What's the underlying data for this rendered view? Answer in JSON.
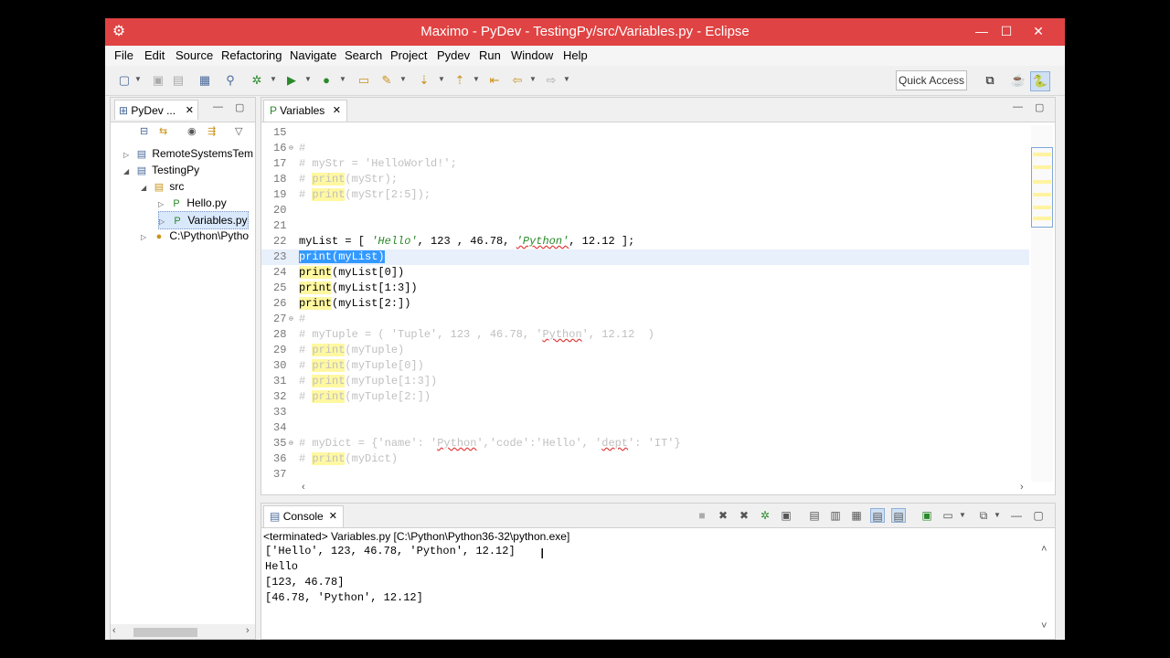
{
  "window": {
    "title": "Maximo - PyDev - TestingPy/src/Variables.py - Eclipse",
    "minimize": "—",
    "maximize": "☐",
    "close": "✕"
  },
  "menu": [
    "File",
    "Edit",
    "Source",
    "Refactoring",
    "Navigate",
    "Search",
    "Project",
    "Pydev",
    "Run",
    "Window",
    "Help"
  ],
  "toolbar": {
    "quick_access": "Quick Access"
  },
  "explorer": {
    "tab_label": "PyDev ...",
    "tree": [
      {
        "label": "RemoteSystemsTem",
        "icon": "folder-icon",
        "arrow": "▷",
        "indent": 0
      },
      {
        "label": "TestingPy",
        "icon": "project-icon",
        "arrow": "◢",
        "indent": 0
      },
      {
        "label": "src",
        "icon": "package-folder-icon",
        "arrow": "◢",
        "indent": 1
      },
      {
        "label": "Hello.py",
        "icon": "python-file-icon",
        "arrow": "▷",
        "indent": 2
      },
      {
        "label": "Variables.py",
        "icon": "python-file-icon",
        "arrow": "▷",
        "indent": 2
      },
      {
        "label": "C:\\Python\\Pytho",
        "icon": "python-interpreter-icon",
        "arrow": "▷",
        "indent": 1
      }
    ]
  },
  "editor": {
    "tab_label": "Variables",
    "lines": [
      {
        "n": "15",
        "segs": []
      },
      {
        "n": "16",
        "fold": "⊖",
        "segs": [
          {
            "t": "#",
            "c": "cm"
          }
        ]
      },
      {
        "n": "17",
        "segs": [
          {
            "t": "# myStr = 'HelloWorld!';",
            "c": "cm"
          }
        ]
      },
      {
        "n": "18",
        "segs": [
          {
            "t": "# ",
            "c": "cm"
          },
          {
            "t": "print",
            "c": "kwc"
          },
          {
            "t": "(myStr);",
            "c": "cm"
          }
        ]
      },
      {
        "n": "19",
        "segs": [
          {
            "t": "# ",
            "c": "cm"
          },
          {
            "t": "print",
            "c": "kwc"
          },
          {
            "t": "(myStr[2:5]);",
            "c": "cm"
          }
        ]
      },
      {
        "n": "20",
        "segs": []
      },
      {
        "n": "21",
        "segs": []
      },
      {
        "n": "22",
        "segs": [
          {
            "t": "myList = [ ",
            "c": ""
          },
          {
            "t": "'Hello'",
            "c": "str"
          },
          {
            "t": ", 123 , 46.78, ",
            "c": ""
          },
          {
            "t": "'Python'",
            "c": "str squig"
          },
          {
            "t": ", 12.12 ];",
            "c": ""
          }
        ]
      },
      {
        "n": "23",
        "current": true,
        "segs": [
          {
            "t": "print(myList)",
            "c": "sel"
          }
        ]
      },
      {
        "n": "24",
        "segs": [
          {
            "t": "print",
            "c": "kw"
          },
          {
            "t": "(myList[0])",
            "c": ""
          }
        ]
      },
      {
        "n": "25",
        "segs": [
          {
            "t": "print",
            "c": "kw"
          },
          {
            "t": "(myList[1:3])",
            "c": ""
          }
        ]
      },
      {
        "n": "26",
        "segs": [
          {
            "t": "print",
            "c": "kw"
          },
          {
            "t": "(myList[2:])",
            "c": ""
          }
        ]
      },
      {
        "n": "27",
        "fold": "⊖",
        "segs": [
          {
            "t": "#",
            "c": "cm"
          }
        ]
      },
      {
        "n": "28",
        "segs": [
          {
            "t": "# myTuple = ( 'Tuple', 123 , 46.78, '",
            "c": "cm"
          },
          {
            "t": "Python",
            "c": "cm squig"
          },
          {
            "t": "', 12.12  )",
            "c": "cm"
          }
        ]
      },
      {
        "n": "29",
        "segs": [
          {
            "t": "# ",
            "c": "cm"
          },
          {
            "t": "print",
            "c": "kwc"
          },
          {
            "t": "(myTuple)",
            "c": "cm"
          }
        ]
      },
      {
        "n": "30",
        "segs": [
          {
            "t": "# ",
            "c": "cm"
          },
          {
            "t": "print",
            "c": "kwc"
          },
          {
            "t": "(myTuple[0])",
            "c": "cm"
          }
        ]
      },
      {
        "n": "31",
        "segs": [
          {
            "t": "# ",
            "c": "cm"
          },
          {
            "t": "print",
            "c": "kwc"
          },
          {
            "t": "(myTuple[1:3])",
            "c": "cm"
          }
        ]
      },
      {
        "n": "32",
        "segs": [
          {
            "t": "# ",
            "c": "cm"
          },
          {
            "t": "print",
            "c": "kwc"
          },
          {
            "t": "(myTuple[2:])",
            "c": "cm"
          }
        ]
      },
      {
        "n": "33",
        "segs": []
      },
      {
        "n": "34",
        "segs": []
      },
      {
        "n": "35",
        "fold": "⊖",
        "segs": [
          {
            "t": "# myDict = {'name': '",
            "c": "cm"
          },
          {
            "t": "Python",
            "c": "cm squig"
          },
          {
            "t": "','code':'Hello', '",
            "c": "cm"
          },
          {
            "t": "dept",
            "c": "cm squig"
          },
          {
            "t": "': 'IT'}",
            "c": "cm"
          }
        ]
      },
      {
        "n": "36",
        "segs": [
          {
            "t": "# ",
            "c": "cm"
          },
          {
            "t": "print",
            "c": "kwc"
          },
          {
            "t": "(myDict)",
            "c": "cm"
          }
        ]
      },
      {
        "n": "37",
        "segs": []
      }
    ]
  },
  "console": {
    "tab_label": "Console",
    "status": "<terminated> Variables.py [C:\\Python\\Python36-32\\python.exe]",
    "output": [
      "['Hello', 123, 46.78, 'Python', 12.12]",
      "Hello",
      "[123, 46.78]",
      "[46.78, 'Python', 12.12]"
    ]
  },
  "colors": {
    "titlebar": "#e04343",
    "selection": "#3399ff",
    "keyword_highlight": "#fff8a0",
    "comment": "#c0c0c0",
    "string": "#2a8a2a"
  }
}
